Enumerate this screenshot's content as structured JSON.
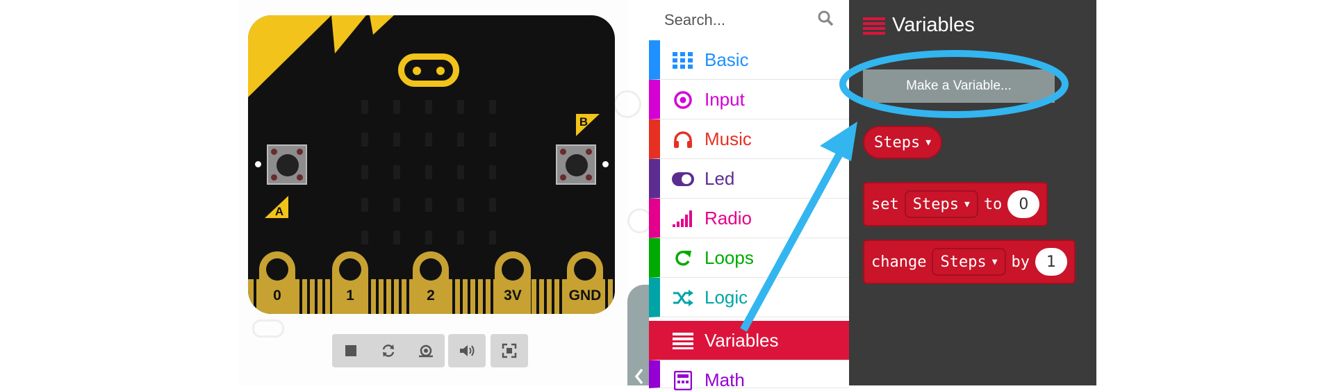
{
  "simulator": {
    "board": {
      "button_a_label": "A",
      "button_b_label": "B",
      "pins": [
        "0",
        "1",
        "2",
        "3V",
        "GND"
      ]
    },
    "toolbar": {
      "stop_icon": "stop-icon",
      "restart_icon": "restart-icon",
      "slow_icon": "snail-icon",
      "sound_icon": "speaker-icon",
      "fullscreen_icon": "fullscreen-icon"
    }
  },
  "toolbox": {
    "search": {
      "placeholder": "Search..."
    },
    "categories": [
      {
        "label": "Basic",
        "color": "#1e90ff",
        "icon": "grid-icon"
      },
      {
        "label": "Input",
        "color": "#d400d4",
        "icon": "target-icon"
      },
      {
        "label": "Music",
        "color": "#e63022",
        "icon": "headphones-icon"
      },
      {
        "label": "Led",
        "color": "#5c2d91",
        "icon": "toggle-icon"
      },
      {
        "label": "Radio",
        "color": "#e3008c",
        "icon": "signal-bars-icon"
      },
      {
        "label": "Loops",
        "color": "#00aa00",
        "icon": "loop-arrow-icon"
      },
      {
        "label": "Logic",
        "color": "#00a4a6",
        "icon": "shuffle-icon"
      },
      {
        "label": "Variables",
        "color": "#dc143c",
        "icon": "list-lines-icon",
        "selected": true
      },
      {
        "label": "Math",
        "color": "#9400d3",
        "icon": "calculator-icon"
      }
    ]
  },
  "flyout": {
    "title": "Variables",
    "make_variable_label": "Make a Variable...",
    "variable_name": "Steps",
    "set_block": {
      "keyword": "set",
      "variable": "Steps",
      "connector": "to",
      "value": "0"
    },
    "change_block": {
      "keyword": "change",
      "variable": "Steps",
      "connector": "by",
      "value": "1"
    }
  },
  "annotation_color": "#33b5f0",
  "block_color": "#c9142a"
}
